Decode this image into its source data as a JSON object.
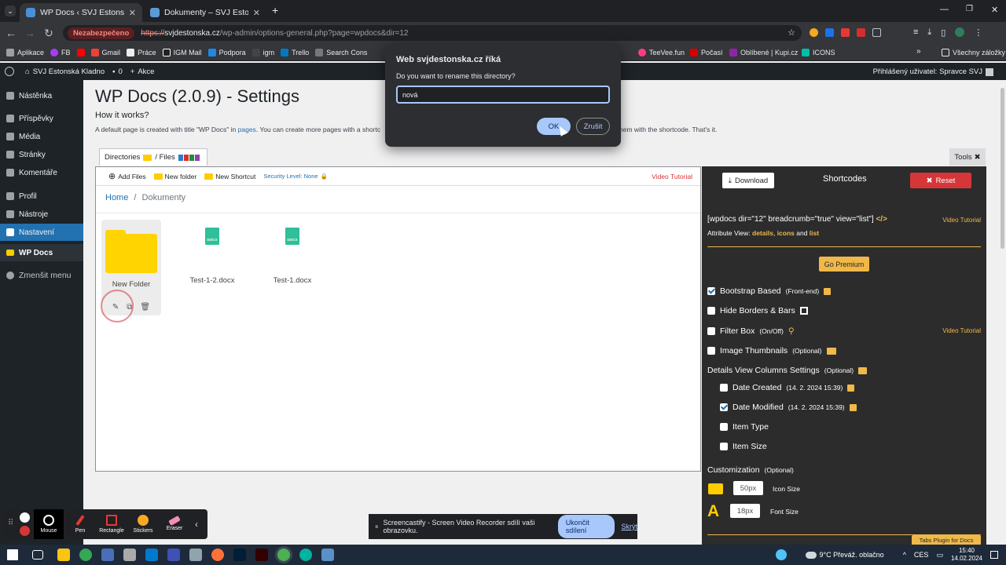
{
  "browser": {
    "tabs": [
      {
        "title": "WP Docs ‹ SVJ Estonská Kladno",
        "active": true
      },
      {
        "title": "Dokumenty – SVJ Estonská Kladno",
        "active": false
      }
    ],
    "new_tab": "+",
    "insecure_label": "Nezabezpečeno",
    "url_scheme": "https://",
    "url_host": "svjdestonska.cz",
    "url_path": "/wp-admin/options-general.php?page=wpdocs&dir=12",
    "bookmarks": [
      "Aplikace",
      "FB",
      "",
      "Gmail",
      "Práce",
      "IGM Mail",
      "Podpora",
      "igm",
      "Trello",
      "Search Cons",
      "ud",
      "TeeVee.fun",
      "Počasí",
      "Oblíbené | Kupi.cz",
      "ICONS"
    ],
    "all_bookmarks": "Všechny záložky"
  },
  "wpbar": {
    "site": "SVJ Estonská Kladno",
    "comments": "0",
    "new": "Akce",
    "user": "Přihlášený uživatel: Spravce SVJ"
  },
  "sidebar": {
    "items": [
      "Nástěnka",
      "Příspěvky",
      "Média",
      "Stránky",
      "Komentáře",
      "Profil",
      "Nástroje",
      "Nastavení",
      "WP Docs",
      "Zmenšit menu"
    ]
  },
  "main": {
    "title": "WP Docs (2.0.9) - Settings",
    "how": "How it works?",
    "desc_a": "A default page is created with title \"WP Docs\" in ",
    "desc_link": "pages",
    "desc_b": ". You can create more pages with a shortc",
    "desc_c": "hem with the shortcode. That's it.",
    "dirtab": "Directories",
    "dirtab_sep": "/ Files",
    "tools": "Tools"
  },
  "filemanager": {
    "add_files": "Add Files",
    "new_folder": "New folder",
    "new_shortcut": "New Shortcut",
    "security": "Security Level: None",
    "video_tutorial": "Video Tutorial",
    "bread_home": "Home",
    "bread_sep": "/",
    "bread_current": "Dokumenty",
    "folder_name": "New Folder",
    "files": [
      {
        "name": "Test-1-2.docx",
        "type": "DOCX"
      },
      {
        "name": "Test-1.docx",
        "type": "DOCX"
      }
    ]
  },
  "panel": {
    "download": "Download",
    "shortcodes": "Shortcodes",
    "reset": "Reset",
    "shortcode": "[wpdocs dir=\"12\" breadcrumb=\"true\" view=\"list\"]",
    "shortcode_icon": "</>",
    "video_tutorial": "Video Tutorial",
    "attr_prefix": "Attribute View: ",
    "attr_details": "details",
    "attr_sep1": ", ",
    "attr_icons": "icons",
    "attr_and": " and ",
    "attr_list": "list",
    "premium": "Go Premium",
    "options": [
      {
        "label": "Bootstrap Based",
        "small": "(Front-end)",
        "checked": true
      },
      {
        "label": "Hide Borders & Bars",
        "small": "",
        "checked": false
      },
      {
        "label": "Filter Box",
        "small": "(On/Off)",
        "checked": false
      },
      {
        "label": "Image Thumbnails",
        "small": "(Optional)",
        "checked": false
      }
    ],
    "filter_video": "Video Tutorial",
    "columns_title": "Details View Columns Settings",
    "columns_small": "(Optional)",
    "columns": [
      {
        "label": "Date Created",
        "small": "(14. 2. 2024 15:39)",
        "checked": false
      },
      {
        "label": "Date Modified",
        "small": "(14. 2. 2024 15:39)",
        "checked": true
      },
      {
        "label": "Item Type",
        "small": "",
        "checked": false
      },
      {
        "label": "Item Size",
        "small": "",
        "checked": false
      }
    ],
    "custom_title": "Customization",
    "custom_small": "(Optional)",
    "icon_size_value": "50px",
    "icon_size_label": "Icon Size",
    "font_size_value": "18px",
    "font_size_label": "Font Size",
    "font_glyph": "A",
    "tabs_plugin": "Tabs Plugin for Docs"
  },
  "dialog": {
    "title": "Web svjdestonska.cz říká",
    "message": "Do you want to rename this directory?",
    "value": "nová",
    "ok": "OK",
    "cancel": "Zrušit"
  },
  "recorder": {
    "tools": [
      "Mouse",
      "Pen",
      "Rectangle",
      "Stickers",
      "Eraser"
    ],
    "share_text": "Screencastify - Screen Video Recorder sdílí vaši obrazovku.",
    "stop": "Ukončit sdílení",
    "hide": "Skrýt"
  },
  "taskbar": {
    "weather": "9°C  Převáž. oblačno",
    "lang": "CES",
    "time": "15:40",
    "date": "14.02.2024"
  },
  "colors": {
    "accent": "#2271b1",
    "gold": "#f0b849",
    "danger": "#d63638",
    "folder": "#ffd400"
  }
}
